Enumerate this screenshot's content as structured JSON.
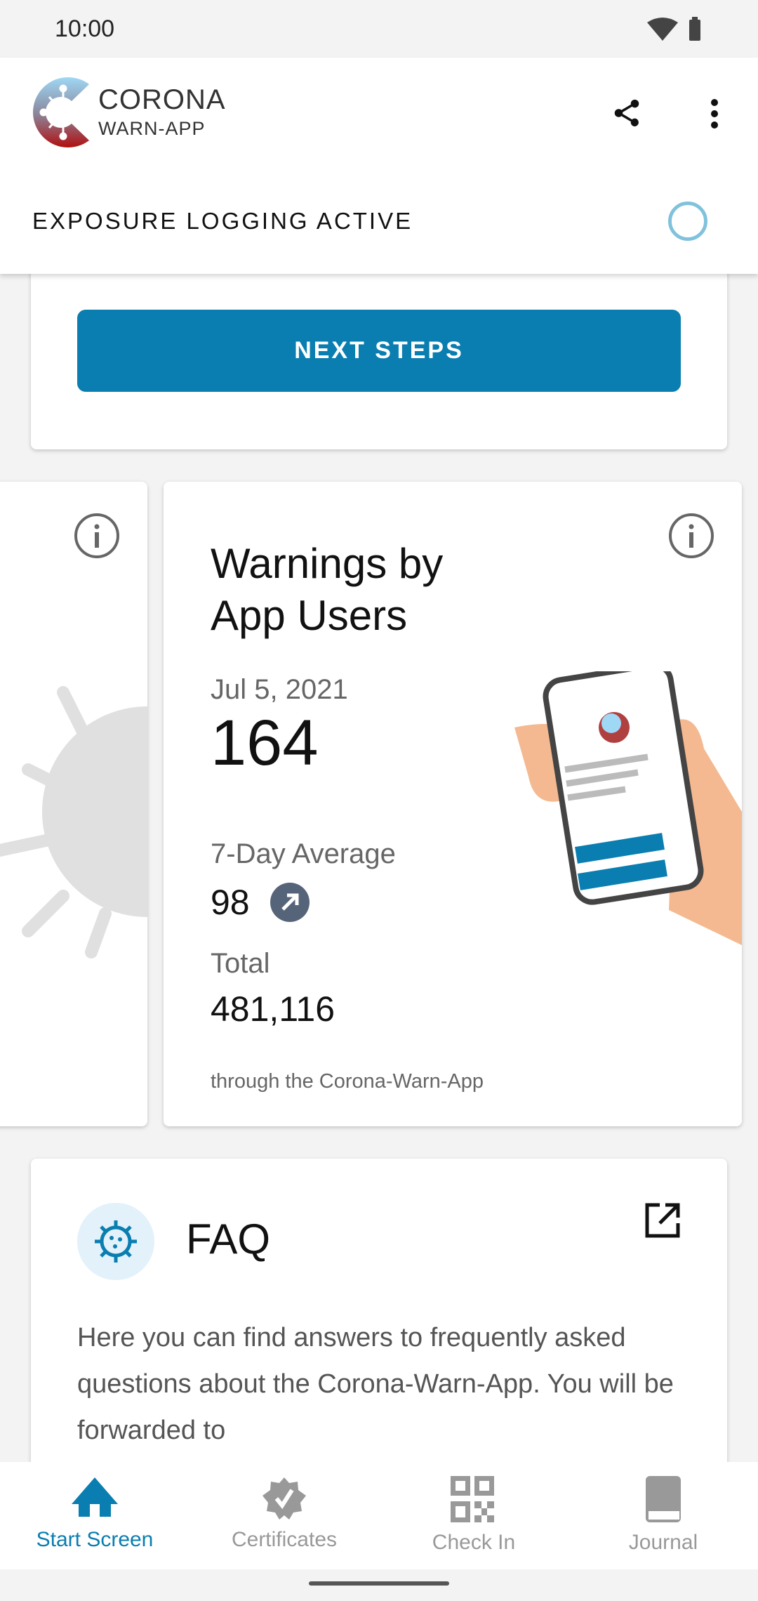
{
  "status_bar": {
    "time": "10:00"
  },
  "app_bar": {
    "logo_line1": "CORONA",
    "logo_line2": "WARN-APP",
    "share_icon": "share-icon",
    "more_icon": "more-vert-icon"
  },
  "exposure": {
    "label": "EXPOSURE LOGGING ACTIVE"
  },
  "risk_card": {
    "next_steps_label": "NEXT STEPS"
  },
  "stats_card": {
    "title_line1": "Warnings by",
    "title_line2": "App Users",
    "date": "Jul 5, 2021",
    "value": "164",
    "avg_label": "7-Day Average",
    "avg_value": "98",
    "trend": "increasing",
    "total_label": "Total",
    "total_value": "481,116",
    "footnote": "through the Corona-Warn-App"
  },
  "faq": {
    "title": "FAQ",
    "body": "Here you can find answers to frequently asked questions about the Corona-Warn-App. You will be forwarded to"
  },
  "bottom_nav": [
    {
      "label": "Start Screen",
      "active": true
    },
    {
      "label": "Certificates"
    },
    {
      "label": "Check In"
    },
    {
      "label": "Journal"
    }
  ],
  "colors": {
    "accent": "#0a7eb0",
    "inactive": "#999999"
  }
}
